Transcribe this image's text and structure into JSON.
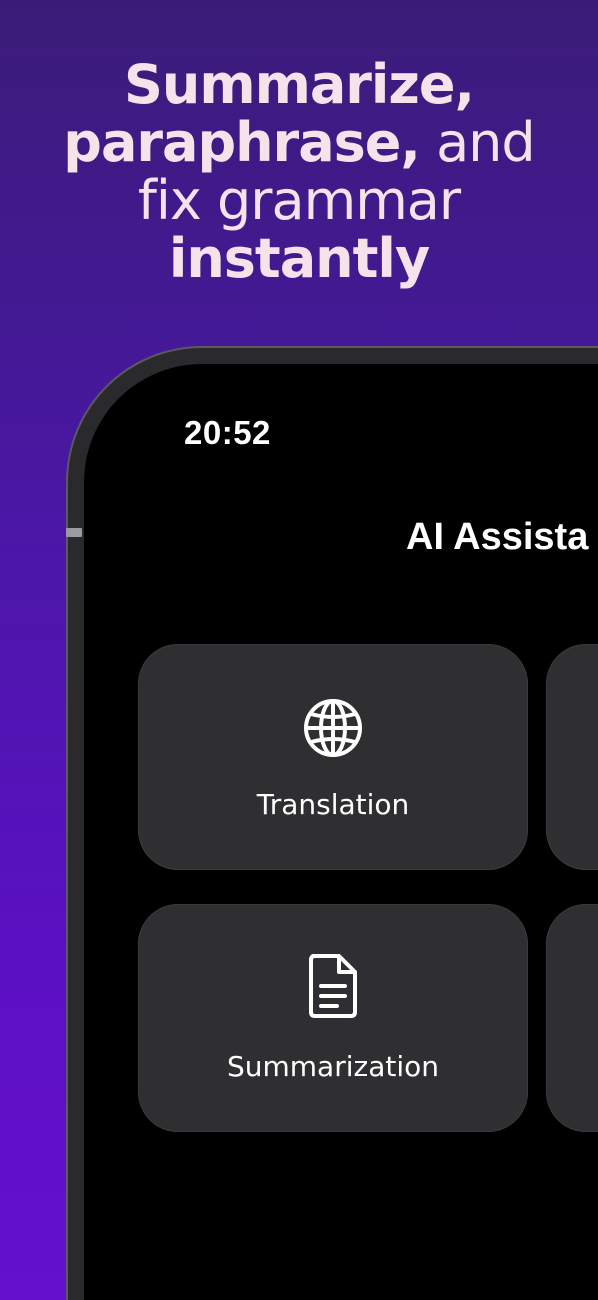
{
  "headline": {
    "line1_bold": "Summarize,",
    "line2_bold": "paraphrase,",
    "line2_light": " and",
    "line3_light": "fix grammar",
    "line4_bold": "instantly"
  },
  "status_bar": {
    "time": "20:52"
  },
  "screen": {
    "title": "AI Assista"
  },
  "cards": [
    {
      "label": "Translation",
      "icon": "globe-icon"
    },
    {
      "label": "Summarization",
      "icon": "document-icon"
    }
  ],
  "colors": {
    "headline_text": "#f6e2ea",
    "card_background": "#2f2f31",
    "screen_background": "#000000",
    "gradient_top": "#3a1c78",
    "gradient_bottom": "#6410cc"
  }
}
